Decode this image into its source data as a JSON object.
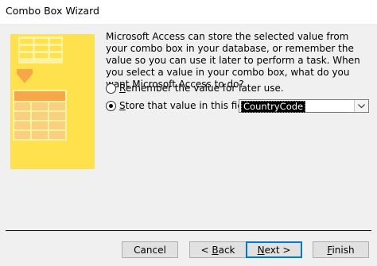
{
  "window": {
    "title": "Combo Box Wizard"
  },
  "description": "Microsoft Access can store the selected value from your combo box in your database, or remember the value so you can use it later to perform a task.  When you select a value in your combo box, what do you want Microsoft Access to do?",
  "options": [
    {
      "prefix": "R",
      "rest": "emember the value for later use.",
      "checked": false
    },
    {
      "prefix": "S",
      "rest": "tore that value in this field:",
      "checked": true
    }
  ],
  "field_combo": {
    "value": "CountryCode"
  },
  "buttons": {
    "cancel": "Cancel",
    "back_prefix": "< ",
    "back_key": "B",
    "back_rest": "ack",
    "next_key": "N",
    "next_rest": "ext >",
    "finish_key": "F",
    "finish_rest": "inish"
  },
  "colors": {
    "illustration_yellow": "#ffe14d",
    "illustration_orange": "#f7a74a",
    "default_button_border": "#0078d7"
  },
  "icons": [
    "table-illustration-icon",
    "chevron-down-icon"
  ]
}
